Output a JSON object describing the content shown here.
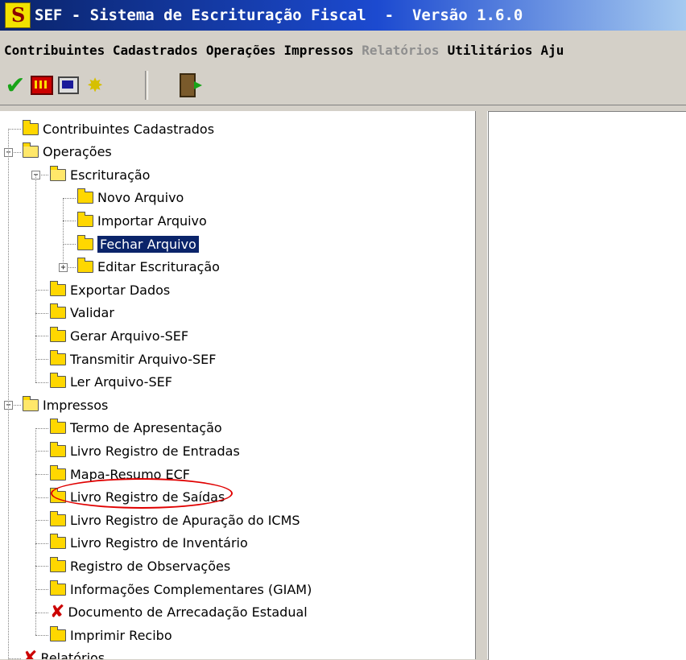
{
  "window": {
    "title": "SEF - Sistema de Escrituração Fiscal  -  Versão 1.6.0"
  },
  "menubar": {
    "items": [
      {
        "label": "Contribuintes Cadastrados",
        "enabled": true
      },
      {
        "label": "Operações",
        "enabled": true
      },
      {
        "label": "Impressos",
        "enabled": true
      },
      {
        "label": "Relatórios",
        "enabled": false
      },
      {
        "label": "Utilitários",
        "enabled": true
      },
      {
        "label": "Aju",
        "enabled": true
      }
    ]
  },
  "toolbar": {
    "icons": [
      "check-icon",
      "film-icon",
      "computer-icon",
      "new-star-icon",
      "exit-door-icon"
    ]
  },
  "tree": {
    "nodes": [
      {
        "label": "Contribuintes Cadastrados",
        "level": 0,
        "icon": "folder-icon"
      },
      {
        "label": "Operações",
        "level": 0,
        "icon": "open-folder-icon",
        "expanded": true
      },
      {
        "label": "Escrituração",
        "level": 1,
        "icon": "open-folder-icon",
        "expanded": true
      },
      {
        "label": "Novo Arquivo",
        "level": 2,
        "icon": "folder-icon"
      },
      {
        "label": "Importar Arquivo",
        "level": 2,
        "icon": "folder-icon"
      },
      {
        "label": "Fechar Arquivo",
        "level": 2,
        "icon": "folder-icon",
        "selected": true
      },
      {
        "label": "Editar Escrituração",
        "level": 2,
        "icon": "folder-icon",
        "expanded": false
      },
      {
        "label": "Exportar Dados",
        "level": 1,
        "icon": "folder-icon"
      },
      {
        "label": "Validar",
        "level": 1,
        "icon": "folder-icon"
      },
      {
        "label": "Gerar Arquivo-SEF",
        "level": 1,
        "icon": "folder-icon"
      },
      {
        "label": "Transmitir Arquivo-SEF",
        "level": 1,
        "icon": "folder-icon"
      },
      {
        "label": "Ler Arquivo-SEF",
        "level": 1,
        "icon": "folder-icon",
        "highlighted": true
      },
      {
        "label": "Impressos",
        "level": 0,
        "icon": "open-folder-icon",
        "expanded": true
      },
      {
        "label": "Termo de Apresentação",
        "level": 1,
        "icon": "folder-icon"
      },
      {
        "label": "Livro Registro de Entradas",
        "level": 1,
        "icon": "folder-icon"
      },
      {
        "label": "Mapa-Resumo ECF",
        "level": 1,
        "icon": "folder-icon"
      },
      {
        "label": "Livro Registro de Saídas",
        "level": 1,
        "icon": "folder-icon"
      },
      {
        "label": "Livro Registro de Apuração do ICMS",
        "level": 1,
        "icon": "folder-icon"
      },
      {
        "label": "Livro Registro de Inventário",
        "level": 1,
        "icon": "folder-icon"
      },
      {
        "label": "Registro de Observações",
        "level": 1,
        "icon": "folder-icon"
      },
      {
        "label": "Informações Complementares (GIAM)",
        "level": 1,
        "icon": "folder-icon"
      },
      {
        "label": "Documento de Arrecadação Estadual",
        "level": 1,
        "icon": "red-x-icon"
      },
      {
        "label": "Imprimir Recibo",
        "level": 1,
        "icon": "folder-icon"
      },
      {
        "label": "Relatórios",
        "level": 0,
        "icon": "red-x-icon"
      }
    ]
  },
  "colors": {
    "selection": "#0a246a",
    "highlight_ring": "#e00000",
    "disabled_menu": "#8f8f8f"
  }
}
